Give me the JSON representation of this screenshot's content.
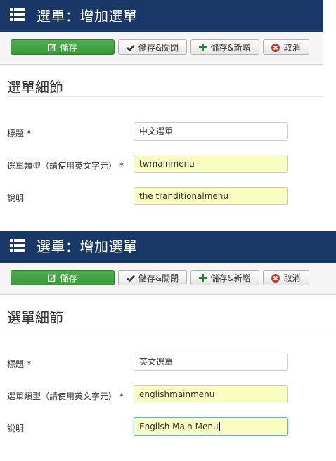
{
  "panels": [
    {
      "header": {
        "title": "選單：增加選單"
      },
      "toolbar": {
        "save": "儲存",
        "save_close": "儲存&關閉",
        "save_new": "儲存&新增",
        "cancel": "取消"
      },
      "section_title": "選單細節",
      "form": {
        "title_label": "標題",
        "title_value": "中文選單",
        "type_label": "選單類型（請使用英文字元）",
        "type_value": "twmainmenu",
        "desc_label": "說明",
        "desc_value": "the tranditionalmenu",
        "required_mark": "*"
      }
    },
    {
      "header": {
        "title": "選單：增加選單"
      },
      "toolbar": {
        "save": "儲存",
        "save_close": "儲存&關閉",
        "save_new": "儲存&新增",
        "cancel": "取消"
      },
      "section_title": "選單細節",
      "form": {
        "title_label": "標題",
        "title_value": "英文選單",
        "type_label": "選單類型（請使用英文字元）",
        "type_value": "englishmainmenu",
        "desc_label": "說明",
        "desc_value": "English Main Menu",
        "required_mark": "*"
      }
    }
  ],
  "icons": {
    "menu": "list-icon",
    "save": "edit-icon",
    "save_close": "check-icon",
    "save_new": "plus-icon",
    "cancel": "cancel-circle-icon"
  },
  "colors": {
    "header_bg": "#1a3867",
    "save_button": "#3a9a3a",
    "highlight_field": "#fafdc0",
    "cancel_icon": "#c0392b"
  }
}
